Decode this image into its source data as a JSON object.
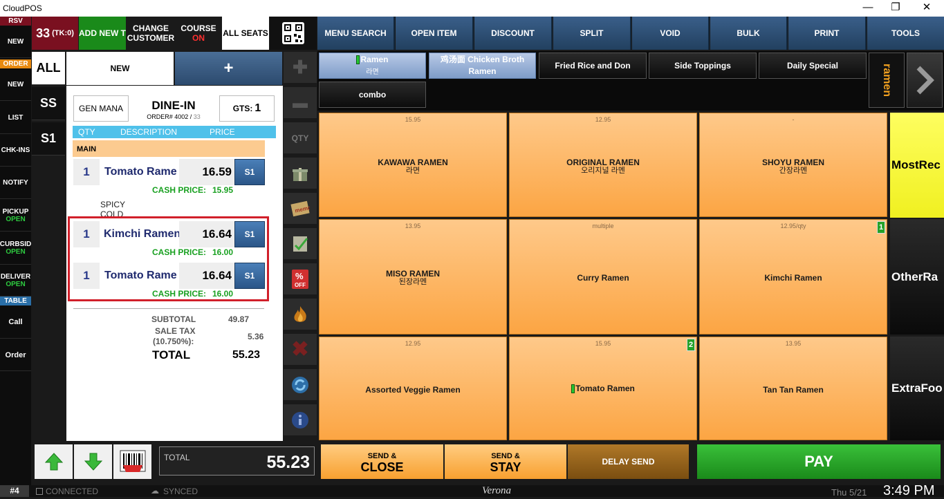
{
  "window": {
    "title": "CloudPOS"
  },
  "leftnav": {
    "rsv": "RSV",
    "rsv_new": "NEW",
    "order": "ORDER",
    "order_new": "NEW",
    "list": "LIST",
    "chkins": "CHK-INS",
    "notify": "NOTIFY",
    "pickup": "PICKUP",
    "pickup_status": "OPEN",
    "curbside": "CURBSID",
    "curbside_status": "OPEN",
    "delivery": "DELIVER",
    "delivery_status": "OPEN",
    "table": "TABLE",
    "call": "Call",
    "order_btn": "Order"
  },
  "topbar": {
    "table_number": "33",
    "table_tk": "(TK:0)",
    "add_new": "ADD NEW T",
    "change_customer": [
      "CHANGE",
      "CUSTOMER"
    ],
    "course": "COURSE",
    "course_status": "ON",
    "all_seats": "ALL SEATS",
    "menu": [
      "MENU SEARCH",
      "OPEN ITEM",
      "DISCOUNT",
      "SPLIT",
      "VOID",
      "BULK",
      "PRINT",
      "TOOLS"
    ]
  },
  "seats": [
    "ALL",
    "SS",
    "S1"
  ],
  "order": {
    "tab_new": "NEW",
    "tab_add": "+",
    "server": "GEN MANA",
    "type": "DINE-IN",
    "order_label": "ORDER# 4002 /",
    "order_table": "33",
    "guests_label": "GTS:",
    "guests": "1",
    "columns": [
      "QTY",
      "DESCRIPTION",
      "PRICE"
    ],
    "section": "MAIN",
    "cash_label": "CASH PRICE:",
    "lines": [
      {
        "qty": "1",
        "desc": "Tomato Rame",
        "price": "16.59",
        "seat": "S1",
        "cash": "15.95"
      },
      {
        "qty": "1",
        "desc": "Kimchi Ramen",
        "price": "16.64",
        "seat": "S1",
        "cash": "16.00"
      },
      {
        "qty": "1",
        "desc": "Tomato Rame",
        "price": "16.64",
        "seat": "S1",
        "cash": "16.00"
      }
    ],
    "modifiers": [
      "SPICY",
      "COLD"
    ],
    "subtotal_label": "SUBTOTAL",
    "subtotal": "49.87",
    "tax_label": [
      "SALE TAX",
      "(10.750%):"
    ],
    "tax": "5.36",
    "total_label": "TOTAL",
    "total": "55.23"
  },
  "tools": {
    "qty": "QTY"
  },
  "categories": [
    "Ramen",
    "鸡汤面 Chicken Broth Ramen",
    "Fried Rice and Don",
    "Side Toppings",
    "Daily Special",
    "combo"
  ],
  "categories_ko": {
    "ramen": "라면"
  },
  "cat_vertical": "ramen",
  "items": [
    {
      "price": "15.95",
      "name": "KAWAWA RAMEN",
      "ko": "라면"
    },
    {
      "price": "12.95",
      "name": "ORIGINAL RAMEN",
      "ko": "오리지널 라멘"
    },
    {
      "price": "-",
      "name": "SHOYU RAMEN",
      "ko": "간장라멘"
    },
    {
      "price": "13.95",
      "name": "MISO RAMEN",
      "ko": "된장라멘"
    },
    {
      "price": "multiple",
      "name": "Curry Ramen",
      "ko": ""
    },
    {
      "price": "12.95/qty",
      "name": "Kimchi Ramen",
      "ko": "",
      "badge": "1"
    },
    {
      "price": "12.95",
      "name": "Assorted Veggie Ramen",
      "ko": ""
    },
    {
      "price": "15.95",
      "name": "Tomato Ramen",
      "ko": "",
      "badge": "2"
    },
    {
      "price": "13.95",
      "name": "Tan Tan Ramen",
      "ko": ""
    }
  ],
  "sidegroups": [
    "MostRec",
    "OtherRa",
    "ExtraFoo"
  ],
  "bottom": {
    "total_label": "TOTAL",
    "total": "55.23",
    "send_close": [
      "SEND &",
      "CLOSE"
    ],
    "send_stay": [
      "SEND &",
      "STAY"
    ],
    "delay_send": "DELAY SEND",
    "pay": "PAY"
  },
  "status": {
    "station": "#4",
    "connected": "CONNECTED",
    "synced": "SYNCED",
    "location": "Verona",
    "date": "Thu 5/21",
    "time": "3:49 PM"
  },
  "colors": {
    "accent_green": "#2ecc40",
    "menu_blue": "#2f5278",
    "item_orange": "#fcb35c",
    "pay_green": "#2aa02a"
  }
}
